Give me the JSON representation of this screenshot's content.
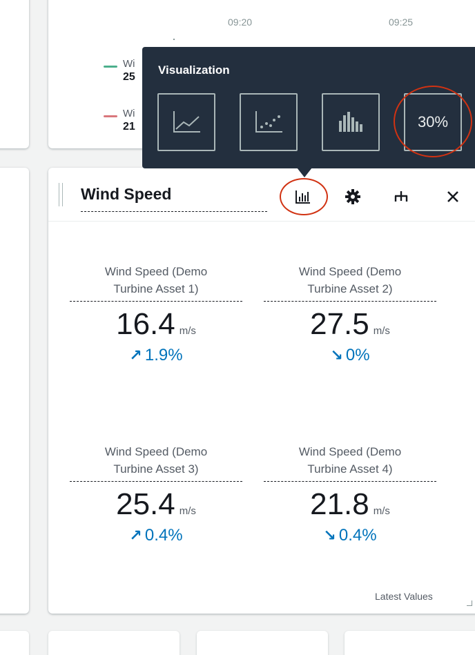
{
  "top_chart": {
    "tick_labels": [
      "09:20",
      "09:25"
    ],
    "legend": [
      {
        "name": "Wi",
        "value": "25",
        "color": "#4caf8c"
      },
      {
        "name": "Wi",
        "value": "21",
        "color": "#d9777c"
      }
    ]
  },
  "visualization_popover": {
    "title": "Visualization",
    "options": [
      {
        "name": "line-chart",
        "icon": "line-chart-icon"
      },
      {
        "name": "scatter-chart",
        "icon": "scatter-chart-icon"
      },
      {
        "name": "bar-chart",
        "icon": "bar-chart-icon"
      },
      {
        "name": "kpi",
        "label": "30%"
      }
    ]
  },
  "widget": {
    "title": "Wind Speed",
    "header_icons": [
      "visualization-icon",
      "settings-icon",
      "properties-icon",
      "close-icon"
    ],
    "kpis": [
      {
        "label_line1": "Wind Speed (Demo",
        "label_line2": "Turbine Asset 1)",
        "value": "16.4",
        "unit": "m/s",
        "arrow": "↗",
        "delta": "1.9%"
      },
      {
        "label_line1": "Wind Speed (Demo",
        "label_line2": "Turbine Asset 2)",
        "value": "27.5",
        "unit": "m/s",
        "arrow": "↘",
        "delta": "0%"
      },
      {
        "label_line1": "Wind Speed (Demo",
        "label_line2": "Turbine Asset 3)",
        "value": "25.4",
        "unit": "m/s",
        "arrow": "↗",
        "delta": "0.4%"
      },
      {
        "label_line1": "Wind Speed (Demo",
        "label_line2": "Turbine Asset 4)",
        "value": "21.8",
        "unit": "m/s",
        "arrow": "↘",
        "delta": "0.4%"
      }
    ],
    "footer": "Latest Values"
  },
  "colors": {
    "accent_blue": "#0073bb",
    "popover_bg": "#232f3e",
    "annotation_red": "#d13212"
  }
}
